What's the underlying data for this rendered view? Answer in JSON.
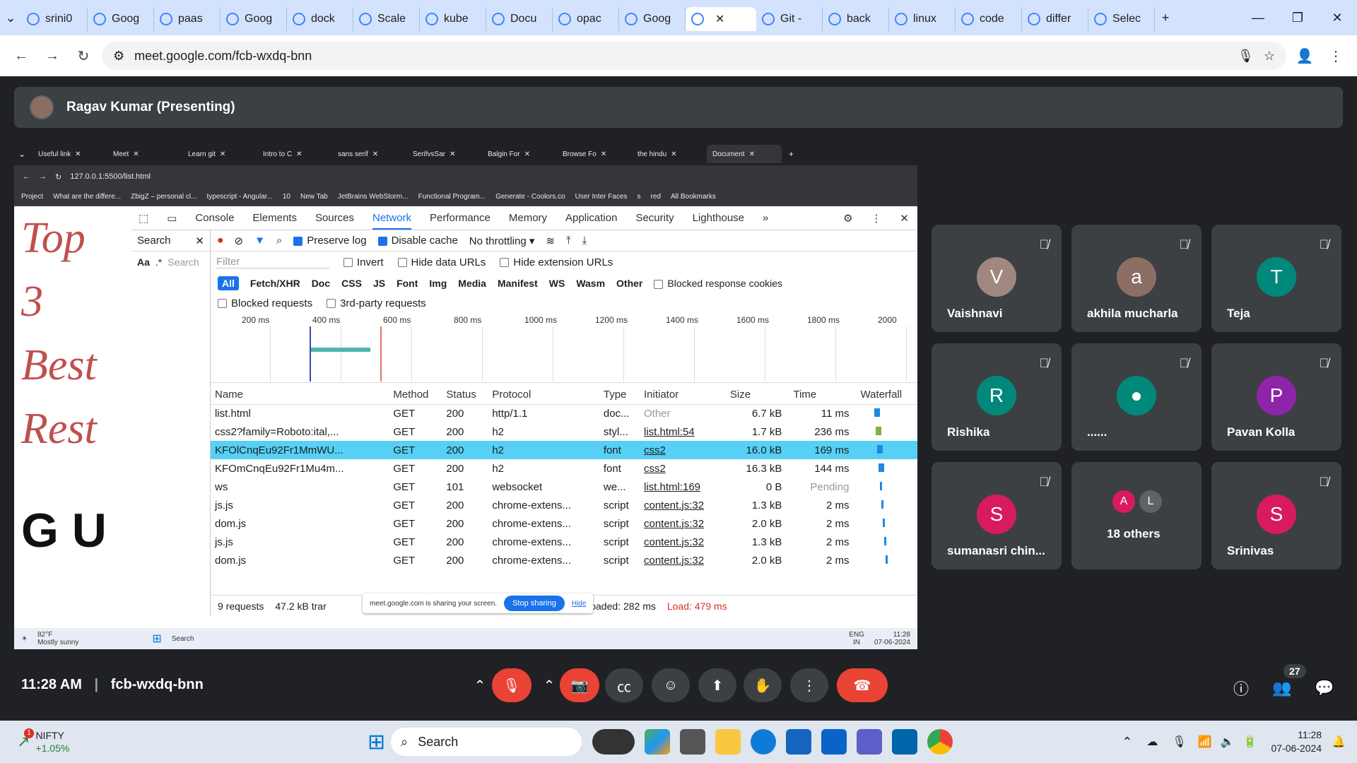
{
  "browser": {
    "tabs": [
      {
        "label": "srini0",
        "icon": "github-icon"
      },
      {
        "label": "Goog",
        "icon": "google-icon"
      },
      {
        "label": "paas",
        "icon": "google-icon"
      },
      {
        "label": "Goog",
        "icon": "google-icon"
      },
      {
        "label": "dock",
        "icon": "google-icon"
      },
      {
        "label": "Scale",
        "icon": "kubernetes-icon"
      },
      {
        "label": "kube",
        "icon": "google-icon"
      },
      {
        "label": "Docu",
        "icon": "docs-icon"
      },
      {
        "label": "opac",
        "icon": "google-icon"
      },
      {
        "label": "Goog",
        "icon": "google-icon"
      },
      {
        "label": "",
        "icon": "meet-icon",
        "active": true
      },
      {
        "label": "Git -",
        "icon": "git-icon"
      },
      {
        "label": "back",
        "icon": "google-icon"
      },
      {
        "label": "linux",
        "icon": "google-icon"
      },
      {
        "label": "code",
        "icon": "google-icon"
      },
      {
        "label": "differ",
        "icon": "google-icon"
      },
      {
        "label": "Selec",
        "icon": "selenium-icon"
      }
    ],
    "url": "meet.google.com/fcb-wxdq-bnn"
  },
  "meeting": {
    "presenter": "Ragav Kumar (Presenting)",
    "time": "11:28 AM",
    "code": "fcb-wxdq-bnn",
    "people_count": "27"
  },
  "shared": {
    "tabs": [
      "Useful link",
      "Meet",
      "Learn git",
      "Intro to C",
      "sans serif",
      "SerifvsSar",
      "Balgin For",
      "Browse Fo",
      "the hindu",
      "Document"
    ],
    "url": "127.0.0.1:5500/list.html",
    "bookmarks": [
      "Project",
      "What are the differe...",
      "ZbigZ – personal cl...",
      "typescript - Angular...",
      "10",
      "New Tab",
      "JetBrains WebStorm...",
      "Functional Program...",
      "Generate - Coolors.co",
      "User Inter Faces",
      "s",
      "red",
      "All Bookmarks"
    ],
    "page_lines": [
      "Top",
      "3",
      "Best",
      "Rest"
    ],
    "page_big": "G U",
    "devtools": {
      "tabs": [
        "Console",
        "Elements",
        "Sources",
        "Network",
        "Performance",
        "Memory",
        "Application",
        "Security",
        "Lighthouse"
      ],
      "search_label": "Search",
      "search_placeholder": "Search",
      "aa": "Aa",
      "preserve_log": "Preserve log",
      "disable_cache": "Disable cache",
      "throttling": "No throttling",
      "filter_placeholder": "Filter",
      "invert": "Invert",
      "hide_data_urls": "Hide data URLs",
      "hide_extension_urls": "Hide extension URLs",
      "types": [
        "All",
        "Fetch/XHR",
        "Doc",
        "CSS",
        "JS",
        "Font",
        "Img",
        "Media",
        "Manifest",
        "WS",
        "Wasm",
        "Other"
      ],
      "blocked_cookies": "Blocked response cookies",
      "blocked_requests": "Blocked requests",
      "third_party": "3rd-party requests",
      "ticks": [
        "200 ms",
        "400 ms",
        "600 ms",
        "800 ms",
        "1000 ms",
        "1200 ms",
        "1400 ms",
        "1600 ms",
        "1800 ms",
        "2000"
      ],
      "columns": [
        "Name",
        "Method",
        "Status",
        "Protocol",
        "Type",
        "Initiator",
        "Size",
        "Time",
        "Waterfall"
      ],
      "rows": [
        {
          "name": "list.html",
          "method": "GET",
          "status": "200",
          "protocol": "http/1.1",
          "type": "doc...",
          "initiator": "Other",
          "size": "6.7 kB",
          "time": "11 ms"
        },
        {
          "name": "css2?family=Roboto:ital,...",
          "method": "GET",
          "status": "200",
          "protocol": "h2",
          "type": "styl...",
          "initiator": "list.html:54",
          "size": "1.7 kB",
          "time": "236 ms"
        },
        {
          "name": "KFOlCnqEu92Fr1MmWU...",
          "method": "GET",
          "status": "200",
          "protocol": "h2",
          "type": "font",
          "initiator": "css2",
          "size": "16.0 kB",
          "time": "169 ms"
        },
        {
          "name": "KFOmCnqEu92Fr1Mu4m...",
          "method": "GET",
          "status": "200",
          "protocol": "h2",
          "type": "font",
          "initiator": "css2",
          "size": "16.3 kB",
          "time": "144 ms"
        },
        {
          "name": "ws",
          "method": "GET",
          "status": "101",
          "protocol": "websocket",
          "type": "we...",
          "initiator": "list.html:169",
          "size": "0 B",
          "time": "Pending"
        },
        {
          "name": "js.js",
          "method": "GET",
          "status": "200",
          "protocol": "chrome-extens...",
          "type": "script",
          "initiator": "content.js:32",
          "size": "1.3 kB",
          "time": "2 ms"
        },
        {
          "name": "dom.js",
          "method": "GET",
          "status": "200",
          "protocol": "chrome-extens...",
          "type": "script",
          "initiator": "content.js:32",
          "size": "2.0 kB",
          "time": "2 ms"
        },
        {
          "name": "js.js",
          "method": "GET",
          "status": "200",
          "protocol": "chrome-extens...",
          "type": "script",
          "initiator": "content.js:32",
          "size": "1.3 kB",
          "time": "2 ms"
        },
        {
          "name": "dom.js",
          "method": "GET",
          "status": "200",
          "protocol": "chrome-extens...",
          "type": "script",
          "initiator": "content.js:32",
          "size": "2.0 kB",
          "time": "2 ms"
        }
      ],
      "status_requests": "9 requests",
      "status_transfer": "47.2 kB trar",
      "status_dcl": "DOMContentLoaded: 282 ms",
      "status_load": "Load: 479 ms"
    },
    "sharing_text": "meet.google.com is sharing your screen.",
    "stop_sharing": "Stop sharing",
    "hide": "Hide",
    "weather_temp": "82°F",
    "weather_desc": "Mostly sunny",
    "taskbar_search": "Search",
    "lang1": "ENG",
    "lang2": "IN",
    "clock_time": "11:28",
    "clock_date": "07-06-2024"
  },
  "participants": [
    {
      "initial": "V",
      "name": "Vaishnavi",
      "color": "#a1887f"
    },
    {
      "initial": "a",
      "name": "akhila mucharla",
      "color": "#8d6e63"
    },
    {
      "initial": "T",
      "name": "Teja",
      "color": "#00897b"
    },
    {
      "initial": "R",
      "name": "Rishika",
      "color": "#00897b"
    },
    {
      "initial": "",
      "name": "......",
      "color": "#00897b"
    },
    {
      "initial": "P",
      "name": "Pavan Kolla",
      "color": "#8e24aa"
    },
    {
      "initial": "S",
      "name": "sumanasri chin...",
      "color": "#d81b60"
    },
    {
      "initial": "",
      "name": "18 others",
      "color": "#3c4043"
    },
    {
      "initial": "S",
      "name": "Srinivas",
      "color": "#d81b60"
    }
  ],
  "others_avatars": [
    "A",
    "L"
  ],
  "taskbar": {
    "stock_name": "NIFTY",
    "stock_change": "+1.05%",
    "stock_badge": "1",
    "search": "Search",
    "time": "11:28",
    "date": "07-06-2024"
  }
}
